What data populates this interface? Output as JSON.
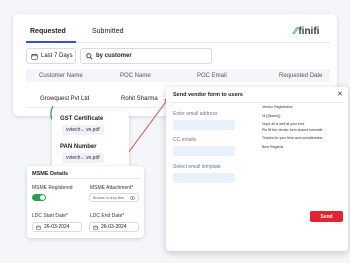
{
  "tabs": [
    {
      "label": "Requested"
    },
    {
      "label": "Submitted"
    }
  ],
  "logo": {
    "mark": "⁄⁄",
    "text": "finifi"
  },
  "filters": {
    "date_range": "Last 7 Days",
    "by_customer": "by customer"
  },
  "table": {
    "columns": [
      "Customer Name",
      "POC Name",
      "POC Email",
      "Requested Date"
    ],
    "rows": [
      {
        "customer": "Growquest Pvt Ltd",
        "poc": "Rohit Sharma"
      }
    ]
  },
  "documents_popover": {
    "gst_title": "GST Certificate",
    "gst_file": "vvtech... ve.pdf",
    "pan_title": "PAN Number",
    "pan_file": "vvtech... ve.pdf"
  },
  "msme_panel": {
    "title": "MSME Details",
    "registered_label": "MSME Registered",
    "attachment_label": "MSME Attachment*",
    "attachment_placeholder": "Browse or drop files",
    "start_label": "LDC Start Date*",
    "start_value": "26-03-2024",
    "end_label": "LDC End Date*",
    "end_value": "26-03-2024"
  },
  "modal": {
    "title": "Send vendor form to users",
    "email_label": "Enter email address",
    "cc_label": "CC emails",
    "template_label": "Select email template",
    "send_label": "Send",
    "close": "✕",
    "preview_lines": [
      "Vendor Registration",
      "Hi {{Name}},",
      "Hope all is well at your end.",
      "Pls fill the vendor form shared herewith.",
      "Thanks for your time and consideration.",
      "Best Regards"
    ]
  },
  "colors": {
    "accent": "#3a4fd0",
    "brand_green": "#2fb36b",
    "send_red": "#e4232f",
    "arrow_red": "#d9534f",
    "arrow_green": "#2e9e4f"
  },
  "icons": [
    "calendar-icon",
    "search-icon",
    "close-icon",
    "eye-icon",
    "toggle-switch",
    "arrow-annotation"
  ]
}
